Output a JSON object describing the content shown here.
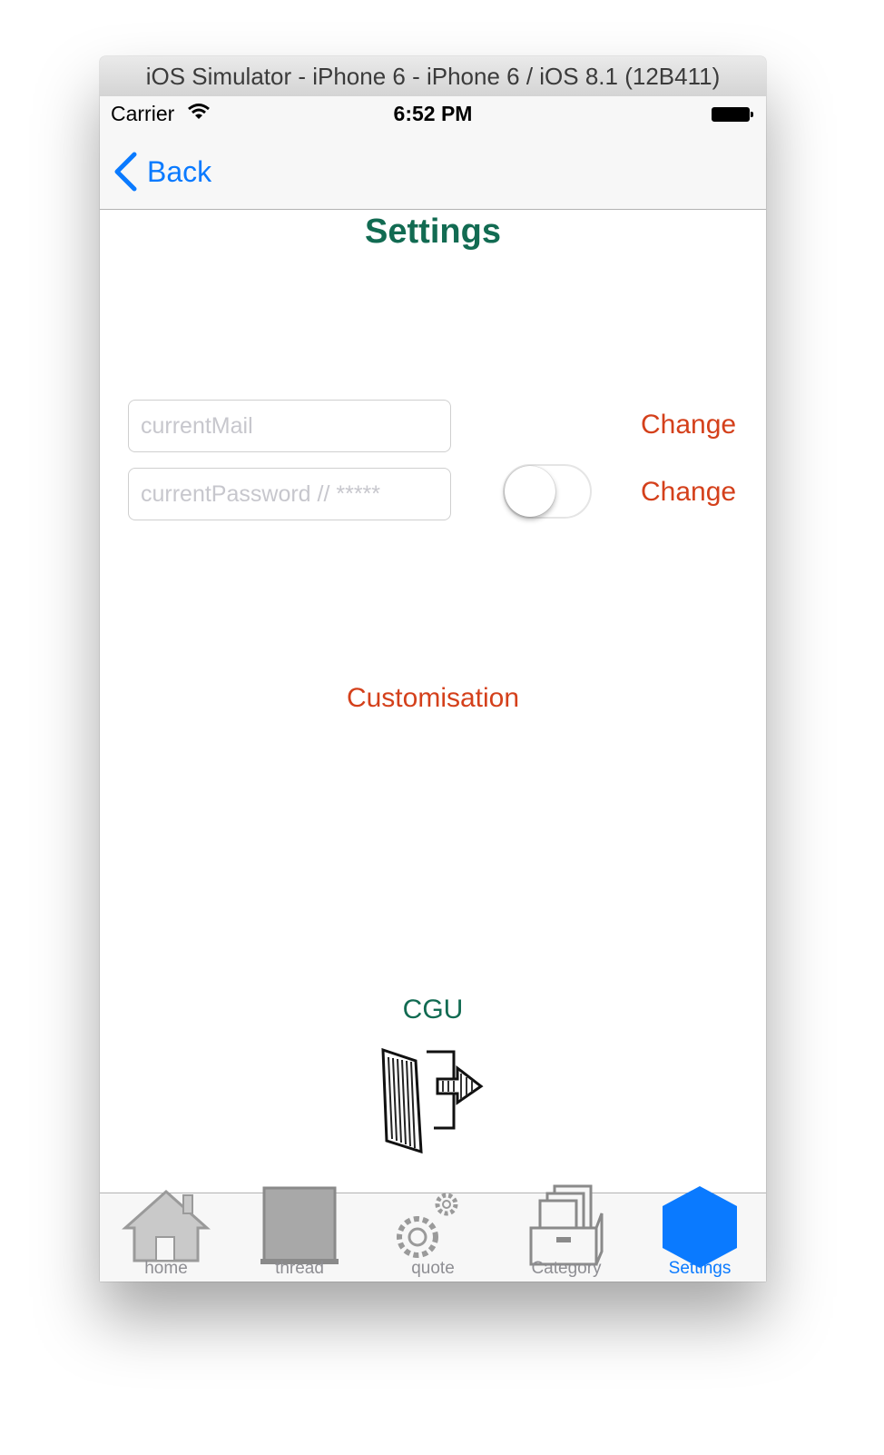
{
  "window": {
    "title": "iOS Simulator - iPhone 6 - iPhone 6 / iOS 8.1 (12B411)"
  },
  "status_bar": {
    "carrier": "Carrier",
    "time": "6:52 PM"
  },
  "nav": {
    "back_label": "Back"
  },
  "page": {
    "title": "Settings"
  },
  "form": {
    "mail_placeholder": "currentMail",
    "password_placeholder": "currentPassword // *****",
    "change_mail_label": "Change",
    "change_password_label": "Change",
    "password_toggle_on": false
  },
  "links": {
    "customisation": "Customisation",
    "cgu": "CGU"
  },
  "tabs": [
    {
      "label": "home",
      "icon": "home-icon",
      "active": false
    },
    {
      "label": "thread",
      "icon": "thread-icon",
      "active": false
    },
    {
      "label": "quote",
      "icon": "gears-icon",
      "active": false
    },
    {
      "label": "Category",
      "icon": "file-box-icon",
      "active": false
    },
    {
      "label": "Settings",
      "icon": "hexagon-icon",
      "active": true
    }
  ],
  "colors": {
    "accent_blue": "#0a7aff",
    "title_green": "#126b52",
    "link_red": "#d4401b"
  }
}
